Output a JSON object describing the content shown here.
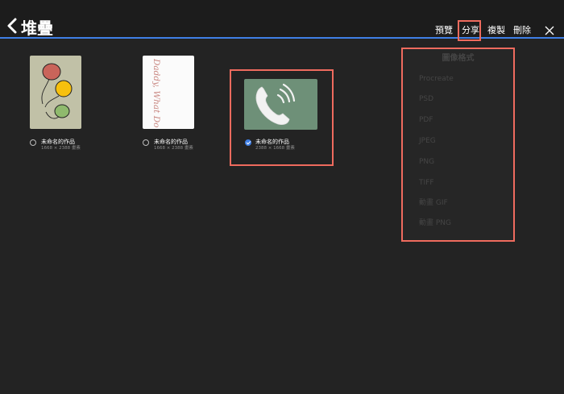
{
  "header": {
    "title": "堆疊",
    "actions": {
      "preview": "預覽",
      "share": "分享",
      "copy": "複製",
      "delete": "刪除"
    }
  },
  "artworks": [
    {
      "name": "未命名的作品",
      "dimensions": "1668 × 2388 畫素",
      "selected": false
    },
    {
      "name": "未命名的作品",
      "dimensions": "1668 × 2388 畫素",
      "selected": false
    },
    {
      "name": "未命名的作品",
      "dimensions": "2388 × 1668 畫素",
      "selected": true
    }
  ],
  "handwriting": "Daddy, What Do You Really D. ?",
  "export_menu": {
    "title": "圖像格式",
    "items": [
      "Procreate",
      "PSD",
      "PDF",
      "JPEG",
      "PNG",
      "TIFF",
      "動畫 GIF",
      "動畫 PNG"
    ]
  },
  "colors": {
    "accent": "#3f7fe6",
    "highlight": "#ef6b5e",
    "background": "#232323",
    "topbar": "#1c1c1c"
  }
}
